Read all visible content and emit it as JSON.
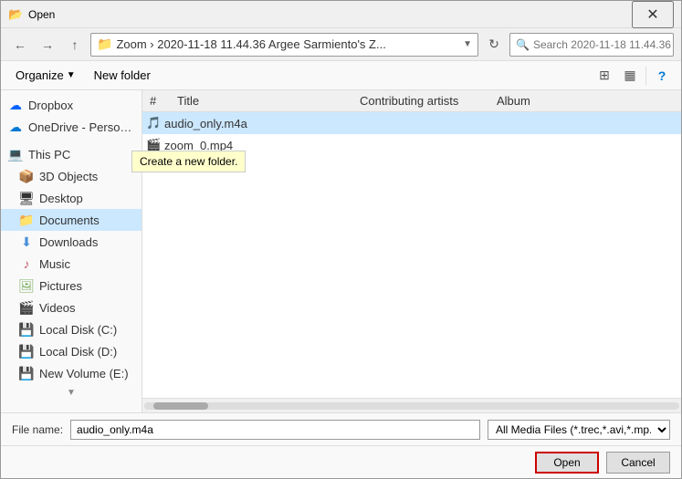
{
  "dialog": {
    "title": "Open",
    "title_icon": "📂"
  },
  "toolbar": {
    "back_label": "←",
    "forward_label": "→",
    "up_label": "↑",
    "address_path": "Zoom  ›  2020-11-18 11.44.36 Argee Sarmiento's Z...",
    "search_placeholder": "Search 2020-11-18 11.44.36 ...",
    "refresh_label": "↻"
  },
  "action_bar": {
    "organize_label": "Organize",
    "new_folder_label": "New folder",
    "new_folder_tooltip": "Create a new folder.",
    "view_label": "⊞",
    "view2_label": "▦",
    "help_label": "?"
  },
  "sidebar": {
    "items": [
      {
        "id": "dropbox",
        "label": "Dropbox",
        "icon": "☁"
      },
      {
        "id": "onedrive",
        "label": "OneDrive - Person...",
        "icon": "☁"
      },
      {
        "id": "separator1",
        "label": "",
        "icon": ""
      },
      {
        "id": "thispc",
        "label": "This PC",
        "icon": "💻"
      },
      {
        "id": "3dobjects",
        "label": "3D Objects",
        "icon": "📦"
      },
      {
        "id": "desktop",
        "label": "Desktop",
        "icon": "🖥"
      },
      {
        "id": "documents",
        "label": "Documents",
        "icon": "📁",
        "active": true
      },
      {
        "id": "downloads",
        "label": "Downloads",
        "icon": "⬇"
      },
      {
        "id": "music",
        "label": "Music",
        "icon": "♪"
      },
      {
        "id": "pictures",
        "label": "Pictures",
        "icon": "🖼"
      },
      {
        "id": "videos",
        "label": "Videos",
        "icon": "🎬"
      },
      {
        "id": "localdisk-c",
        "label": "Local Disk (C:)",
        "icon": "💾"
      },
      {
        "id": "localdisk-d",
        "label": "Local Disk (D:)",
        "icon": "💾"
      },
      {
        "id": "newvolume",
        "label": "New Volume (E:)",
        "icon": "💾"
      }
    ]
  },
  "columns": {
    "hash": "#",
    "title": "Title",
    "contributing_artists": "Contributing artists",
    "album": "Album"
  },
  "files": [
    {
      "id": "audio",
      "name": "audio_only.m4a",
      "icon": "🎵",
      "selected": true
    },
    {
      "id": "zoom",
      "name": "zoom_0.mp4",
      "icon": "🎬",
      "selected": false
    }
  ],
  "bottom": {
    "filename_label": "File name:",
    "filename_value": "audio_only.m4a",
    "filetype_label": "All Media Files",
    "filetype_value": "All Media Files (*.trec,*.avi,*.mp...",
    "open_label": "Open",
    "cancel_label": "Cancel"
  }
}
